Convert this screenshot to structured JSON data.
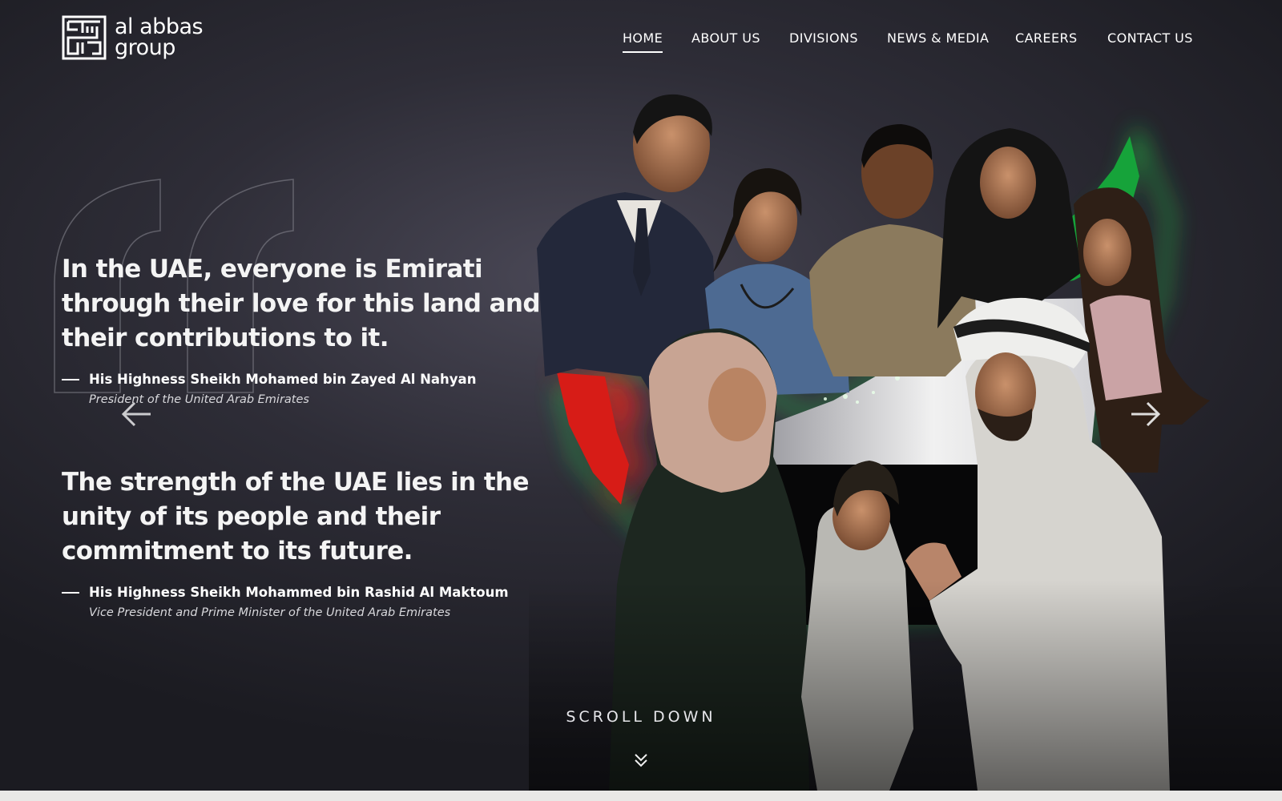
{
  "brand": {
    "logo_line1": "al abbas",
    "logo_line2": "group",
    "logo_icon": "kufic-square-logo"
  },
  "nav": {
    "items": [
      {
        "label": "HOME",
        "active": true
      },
      {
        "label": "ABOUT US",
        "active": false
      },
      {
        "label": "DIVISIONS",
        "active": false
      },
      {
        "label": "NEWS & MEDIA",
        "active": false
      },
      {
        "label": "CAREERS",
        "active": false
      },
      {
        "label": "CONTACT US",
        "active": false
      }
    ]
  },
  "hero": {
    "quotes": [
      {
        "text": "In the UAE, everyone is Emirati through their love for this land and their contributions to it.",
        "author": "His Highness Sheikh Mohamed bin Zayed Al Nahyan",
        "role": "President of the United Arab Emirates"
      },
      {
        "text": "The strength of the UAE lies in the unity of its people and their commitment to its future.",
        "author": "His Highness Sheikh Mohammed bin Rashid Al Maktoum",
        "role": "Vice President and Prime Minister of the United Arab Emirates"
      }
    ],
    "scroll_label": "SCROLL DOWN",
    "prev_icon": "arrow-left-icon",
    "next_icon": "arrow-right-icon",
    "scroll_icon": "double-chevron-down-icon"
  },
  "colors": {
    "background_dark": "#1b1b21",
    "background_mid": "#4a4856",
    "text": "#ffffff",
    "flag_red": "#e8231c",
    "flag_green": "#1fbf3c",
    "flag_white": "#f2f2f2",
    "flag_black": "#0a0a0a",
    "page_strip": "#e9e8e6"
  }
}
